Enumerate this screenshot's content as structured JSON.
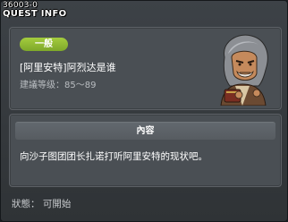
{
  "quest": {
    "id": "36003-0",
    "window_title": "QUEST INFO",
    "level_badge": "一般",
    "name": "[阿里安特]阿烈达是谁",
    "recommended_level": "建議等级：85～89",
    "content_header": "內容",
    "content_text": "向沙子图团团长扎诺打听阿里安特的现状吧。",
    "status": "狀態： 可開始"
  },
  "colors": {
    "window_bg": "#34383c",
    "panel_bg": "#4a4f54",
    "badge_green": "#8fb934",
    "text_white": "#ffffff",
    "text_grey": "#b9bdc1"
  },
  "npc": {
    "icon": "npc-portrait-icon"
  }
}
